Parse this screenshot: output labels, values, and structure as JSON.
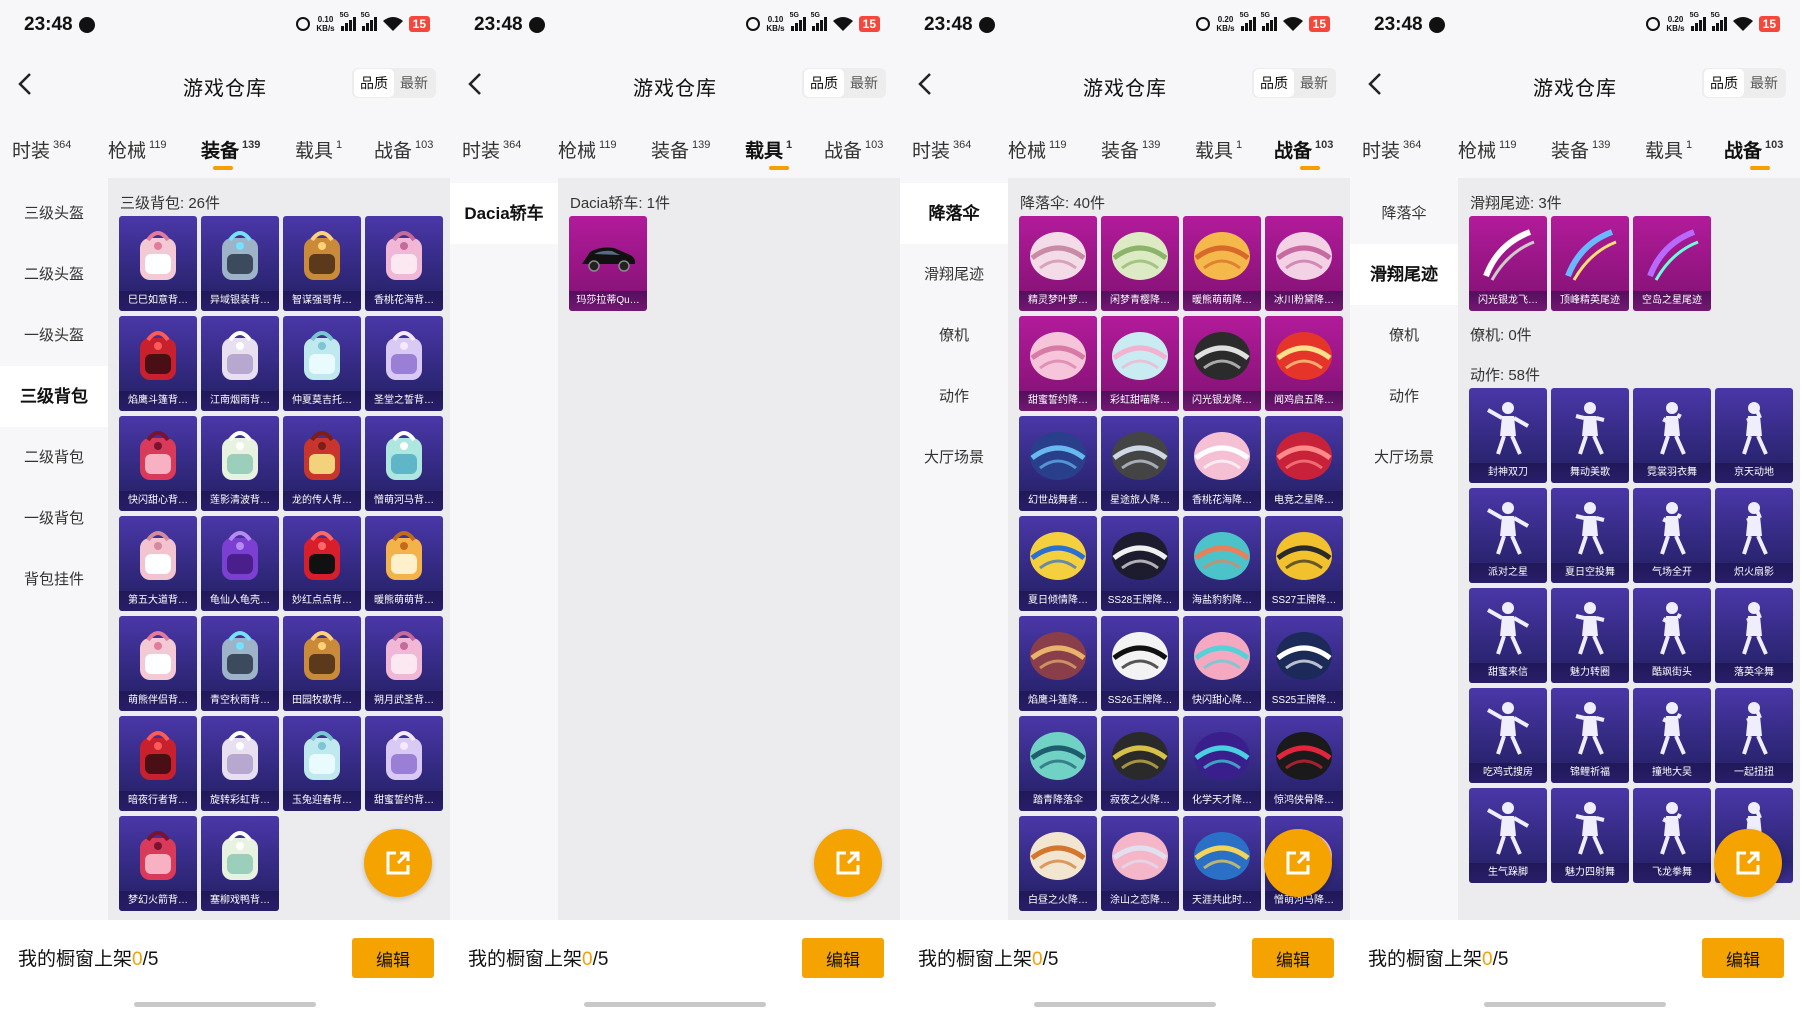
{
  "status": {
    "time": "23:48",
    "battery": "15",
    "net_a": [
      "0.10",
      "KB/s"
    ],
    "net_b": [
      "0.20",
      "KB/s"
    ],
    "sig": "5G"
  },
  "header": {
    "title": "游戏仓库",
    "sort_quality": "品质",
    "sort_latest": "最新"
  },
  "tabs": [
    {
      "label": "时装",
      "count": "364"
    },
    {
      "label": "枪械",
      "count": "119"
    },
    {
      "label": "装备",
      "count": "139"
    },
    {
      "label": "载具",
      "count": "1"
    },
    {
      "label": "战备",
      "count": "103"
    }
  ],
  "bottom": {
    "shelf_label": "我的橱窗上架",
    "shelf_count": "0",
    "shelf_total": "/5",
    "edit": "编辑"
  },
  "panels": [
    {
      "active_tab": 2,
      "categories": [
        "三级头盔",
        "二级头盔",
        "一级头盔",
        "三级背包",
        "二级背包",
        "一级背包",
        "背包挂件"
      ],
      "selected_category": 3,
      "sections": [
        {
          "title": "三级背包: 26件",
          "style": "purple",
          "items": [
            "巳巳如意背…",
            "异域银装背…",
            "智谋强哥背…",
            "香桃花海背…",
            "焰鹰斗篷背…",
            "江南烟雨背…",
            "仲夏莫吉托…",
            "圣堂之誓背…",
            "快闪甜心背…",
            "莲影清波背…",
            "龙的传人背…",
            "憎萌河马背…",
            "第五大道背…",
            "龟仙人龟壳…",
            "妙红点点背…",
            "暖熊萌萌背…",
            "萌熊伴侣背…",
            "青空秋雨背…",
            "田园牧歌背…",
            "朔月武圣背…",
            "暗夜行者背…",
            "旋转彩虹背…",
            "玉兔迎春背…",
            "甜蜜誓约背…",
            "梦幻火箭背…",
            "塞柳戏鸭背…"
          ]
        }
      ]
    },
    {
      "active_tab": 3,
      "categories": [
        "Dacia轿车"
      ],
      "selected_category": 0,
      "sections": [
        {
          "title": "Dacia轿车: 1件",
          "style": "pink",
          "items": [
            "玛莎拉蒂Qu…"
          ]
        }
      ]
    },
    {
      "active_tab": 4,
      "categories": [
        "降落伞",
        "滑翔尾迹",
        "僚机",
        "动作",
        "大厅场景"
      ],
      "selected_category": 0,
      "sections": [
        {
          "title": "降落伞: 40件",
          "style": "mixed",
          "items": [
            "精灵梦叶萝…",
            "闲梦青樱降…",
            "暖熊萌萌降…",
            "冰川粉黛降…",
            "甜蜜誓约降…",
            "彩虹甜喵降…",
            "闪光银龙降…",
            "闻鸡启五降…",
            "幻世战舞者…",
            "星途旅人降…",
            "香桃花海降…",
            "电竞之星降…",
            "夏日倾情降…",
            "SS28王牌降…",
            "海盐豹豹降…",
            "SS27王牌降…",
            "焰鹰斗篷降…",
            "SS26王牌降…",
            "快闪甜心降…",
            "SS25王牌降…",
            "踏青降落伞",
            "寂夜之火降…",
            "化学天才降…",
            "惊鸿侠骨降…",
            "白昼之火降…",
            "涂山之恋降…",
            "天涯共此时…",
            "憎萌河马降…"
          ]
        }
      ]
    },
    {
      "active_tab": 4,
      "categories": [
        "降落伞",
        "滑翔尾迹",
        "僚机",
        "动作",
        "大厅场景"
      ],
      "selected_category": 1,
      "sections": [
        {
          "title": "滑翔尾迹: 3件",
          "style": "mixed",
          "items": [
            "闪光银龙飞…",
            "顶峰精英尾迹",
            "空岛之星尾迹"
          ]
        },
        {
          "title": "僚机: 0件",
          "style": "purple",
          "items": []
        },
        {
          "title": "动作: 58件",
          "style": "purple",
          "items": [
            "封神双刀",
            "舞动美歌",
            "霓裳羽衣舞",
            "京天动地",
            "派对之星",
            "夏日空投舞",
            "气场全开",
            "炽火扇影",
            "甜蜜来信",
            "魅力转圈",
            "酷飒街头",
            "落英伞舞",
            "吃鸡式搜房",
            "锦鲤祈福",
            "撞地大吴",
            "一起扭扭",
            "生气跺脚",
            "魅力四射舞",
            "飞龙拳舞",
            ""
          ]
        }
      ]
    }
  ]
}
